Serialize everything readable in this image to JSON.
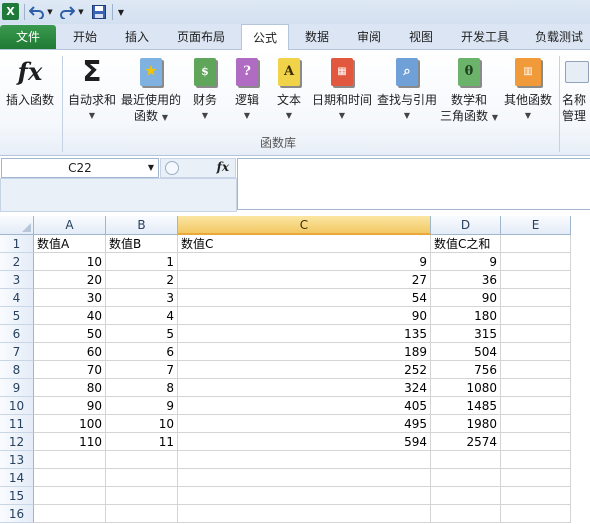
{
  "qat": {
    "app_icon": "X",
    "undo_icon": "undo-icon",
    "redo_icon": "redo-icon",
    "save_icon": "save-icon"
  },
  "tabs": [
    {
      "label": "文件",
      "file": true
    },
    {
      "label": "开始"
    },
    {
      "label": "插入"
    },
    {
      "label": "页面布局"
    },
    {
      "label": "公式",
      "active": true
    },
    {
      "label": "数据"
    },
    {
      "label": "审阅"
    },
    {
      "label": "视图"
    },
    {
      "label": "开发工具"
    },
    {
      "label": "负载测试"
    }
  ],
  "ribbon": {
    "insert_function": "插入函数",
    "autosum": "自动求和",
    "recent_line1": "最近使用的",
    "recent_line2": "函数",
    "financial": "财务",
    "logical": "逻辑",
    "text": "文本",
    "datetime": "日期和时间",
    "lookup": "查找与引用",
    "math_line1": "数学和",
    "math_line2": "三角函数",
    "other": "其他函数",
    "name_line1": "名称",
    "name_line2": "管理",
    "group_label": "函数库",
    "fx_glyph": "fx",
    "sigma_glyph": "Σ",
    "logical_glyph": "?",
    "text_glyph": "A",
    "math_glyph": "θ"
  },
  "formula_bar": {
    "name_box": "C22",
    "fx_label": "fx",
    "formula": ""
  },
  "columns": [
    {
      "label": "A"
    },
    {
      "label": "B"
    },
    {
      "label": "C",
      "selected": true
    },
    {
      "label": "D"
    },
    {
      "label": "E"
    }
  ],
  "rows": [
    {
      "num": "1",
      "cells": [
        "数值A",
        "数值B",
        "数值C",
        "数值C之和",
        ""
      ],
      "header": true
    },
    {
      "num": "2",
      "cells": [
        "10",
        "1",
        "9",
        "9",
        ""
      ]
    },
    {
      "num": "3",
      "cells": [
        "20",
        "2",
        "27",
        "36",
        ""
      ]
    },
    {
      "num": "4",
      "cells": [
        "30",
        "3",
        "54",
        "90",
        ""
      ]
    },
    {
      "num": "5",
      "cells": [
        "40",
        "4",
        "90",
        "180",
        ""
      ]
    },
    {
      "num": "6",
      "cells": [
        "50",
        "5",
        "135",
        "315",
        ""
      ]
    },
    {
      "num": "7",
      "cells": [
        "60",
        "6",
        "189",
        "504",
        ""
      ]
    },
    {
      "num": "8",
      "cells": [
        "70",
        "7",
        "252",
        "756",
        ""
      ]
    },
    {
      "num": "9",
      "cells": [
        "80",
        "8",
        "324",
        "1080",
        ""
      ]
    },
    {
      "num": "10",
      "cells": [
        "90",
        "9",
        "405",
        "1485",
        ""
      ]
    },
    {
      "num": "11",
      "cells": [
        "100",
        "10",
        "495",
        "1980",
        ""
      ]
    },
    {
      "num": "12",
      "cells": [
        "110",
        "11",
        "594",
        "2574",
        ""
      ]
    },
    {
      "num": "13",
      "cells": [
        "",
        "",
        "",
        "",
        ""
      ]
    },
    {
      "num": "14",
      "cells": [
        "",
        "",
        "",
        "",
        ""
      ]
    },
    {
      "num": "15",
      "cells": [
        "",
        "",
        "",
        "",
        ""
      ]
    },
    {
      "num": "16",
      "cells": [
        "",
        "",
        "",
        "",
        ""
      ]
    }
  ]
}
